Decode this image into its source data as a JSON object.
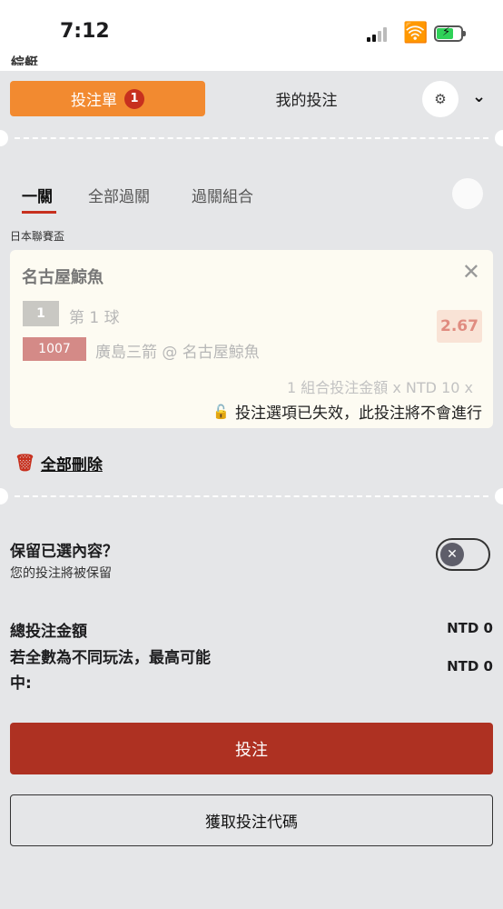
{
  "status_bar": {
    "time": "7:12",
    "behind_text": "綜艇"
  },
  "header": {
    "betslip_tab": "投注單",
    "betslip_count": "1",
    "my_bets_tab": "我的投注",
    "gear_icon": "gear-icon",
    "chevron_icon": "chevron-down-icon"
  },
  "bet_types": {
    "single": "一關",
    "all_parlay": "全部過關",
    "parlay_combo": "過關組合"
  },
  "league": "日本聯賽盃",
  "bet_card": {
    "team": "名古屋鯨魚",
    "selection_chip": "1",
    "selection_text": "第 1 球",
    "odds": "2.67",
    "match_chip": "1007",
    "match_text": "廣島三箭 @ 名古屋鯨魚",
    "combo_text": "1 組合投注金額 x NTD 10 x",
    "warning": "投注選項已失效，此投注將不會進行"
  },
  "delete_all": "全部刪除",
  "retain": {
    "title": "保留已選內容？",
    "subtitle": "您的投注將被保留"
  },
  "totals": {
    "stake_label": "總投注金額",
    "stake_value": "NTD 0",
    "max_win_label_line1": "若全數為不同玩法，最高可能",
    "max_win_label_line2": "中:",
    "max_win_value": "NTD 0"
  },
  "buttons": {
    "place_bet": "投注",
    "get_code": "獲取投注代碼"
  },
  "colors": {
    "accent_orange": "#f28a30",
    "accent_red": "#ae3122",
    "badge_red": "#c7301e"
  }
}
